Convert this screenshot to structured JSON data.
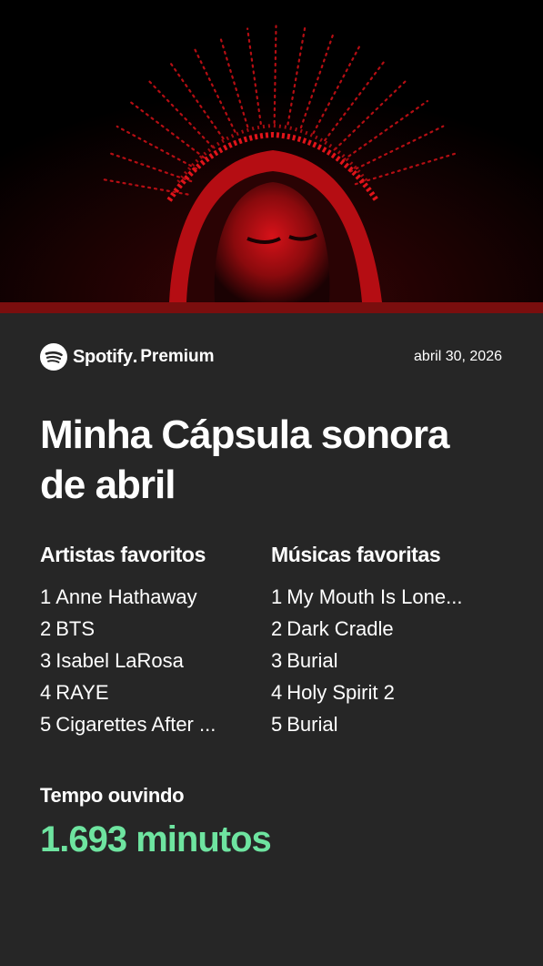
{
  "header": {
    "brand": "Spotify",
    "brand_dot": ".",
    "tier": "Premium",
    "date": "abril 30, 2026"
  },
  "title": {
    "line1": "Minha Cápsula sonora",
    "line2": "de abril"
  },
  "artists": {
    "heading": "Artistas favoritos",
    "items": [
      {
        "rank": "1",
        "name": "Anne Hathaway"
      },
      {
        "rank": "2",
        "name": "BTS"
      },
      {
        "rank": "3",
        "name": "Isabel LaRosa"
      },
      {
        "rank": "4",
        "name": "RAYE"
      },
      {
        "rank": "5",
        "name": "Cigarettes After ..."
      }
    ]
  },
  "songs": {
    "heading": "Músicas favoritas",
    "items": [
      {
        "rank": "1",
        "name": "My Mouth Is Lone..."
      },
      {
        "rank": "2",
        "name": "Dark Cradle"
      },
      {
        "rank": "3",
        "name": "Burial"
      },
      {
        "rank": "4",
        "name": "Holy Spirit 2"
      },
      {
        "rank": "5",
        "name": "Burial"
      }
    ]
  },
  "listening": {
    "label": "Tempo ouvindo",
    "value": "1.693 minutos"
  },
  "icons": {
    "logo": "spotify-logo-icon"
  },
  "colors": {
    "card_bg": "#262626",
    "accent_green": "#6ee4a0",
    "band_red": "#7a0e0e",
    "hero_red": "#e0141a"
  }
}
